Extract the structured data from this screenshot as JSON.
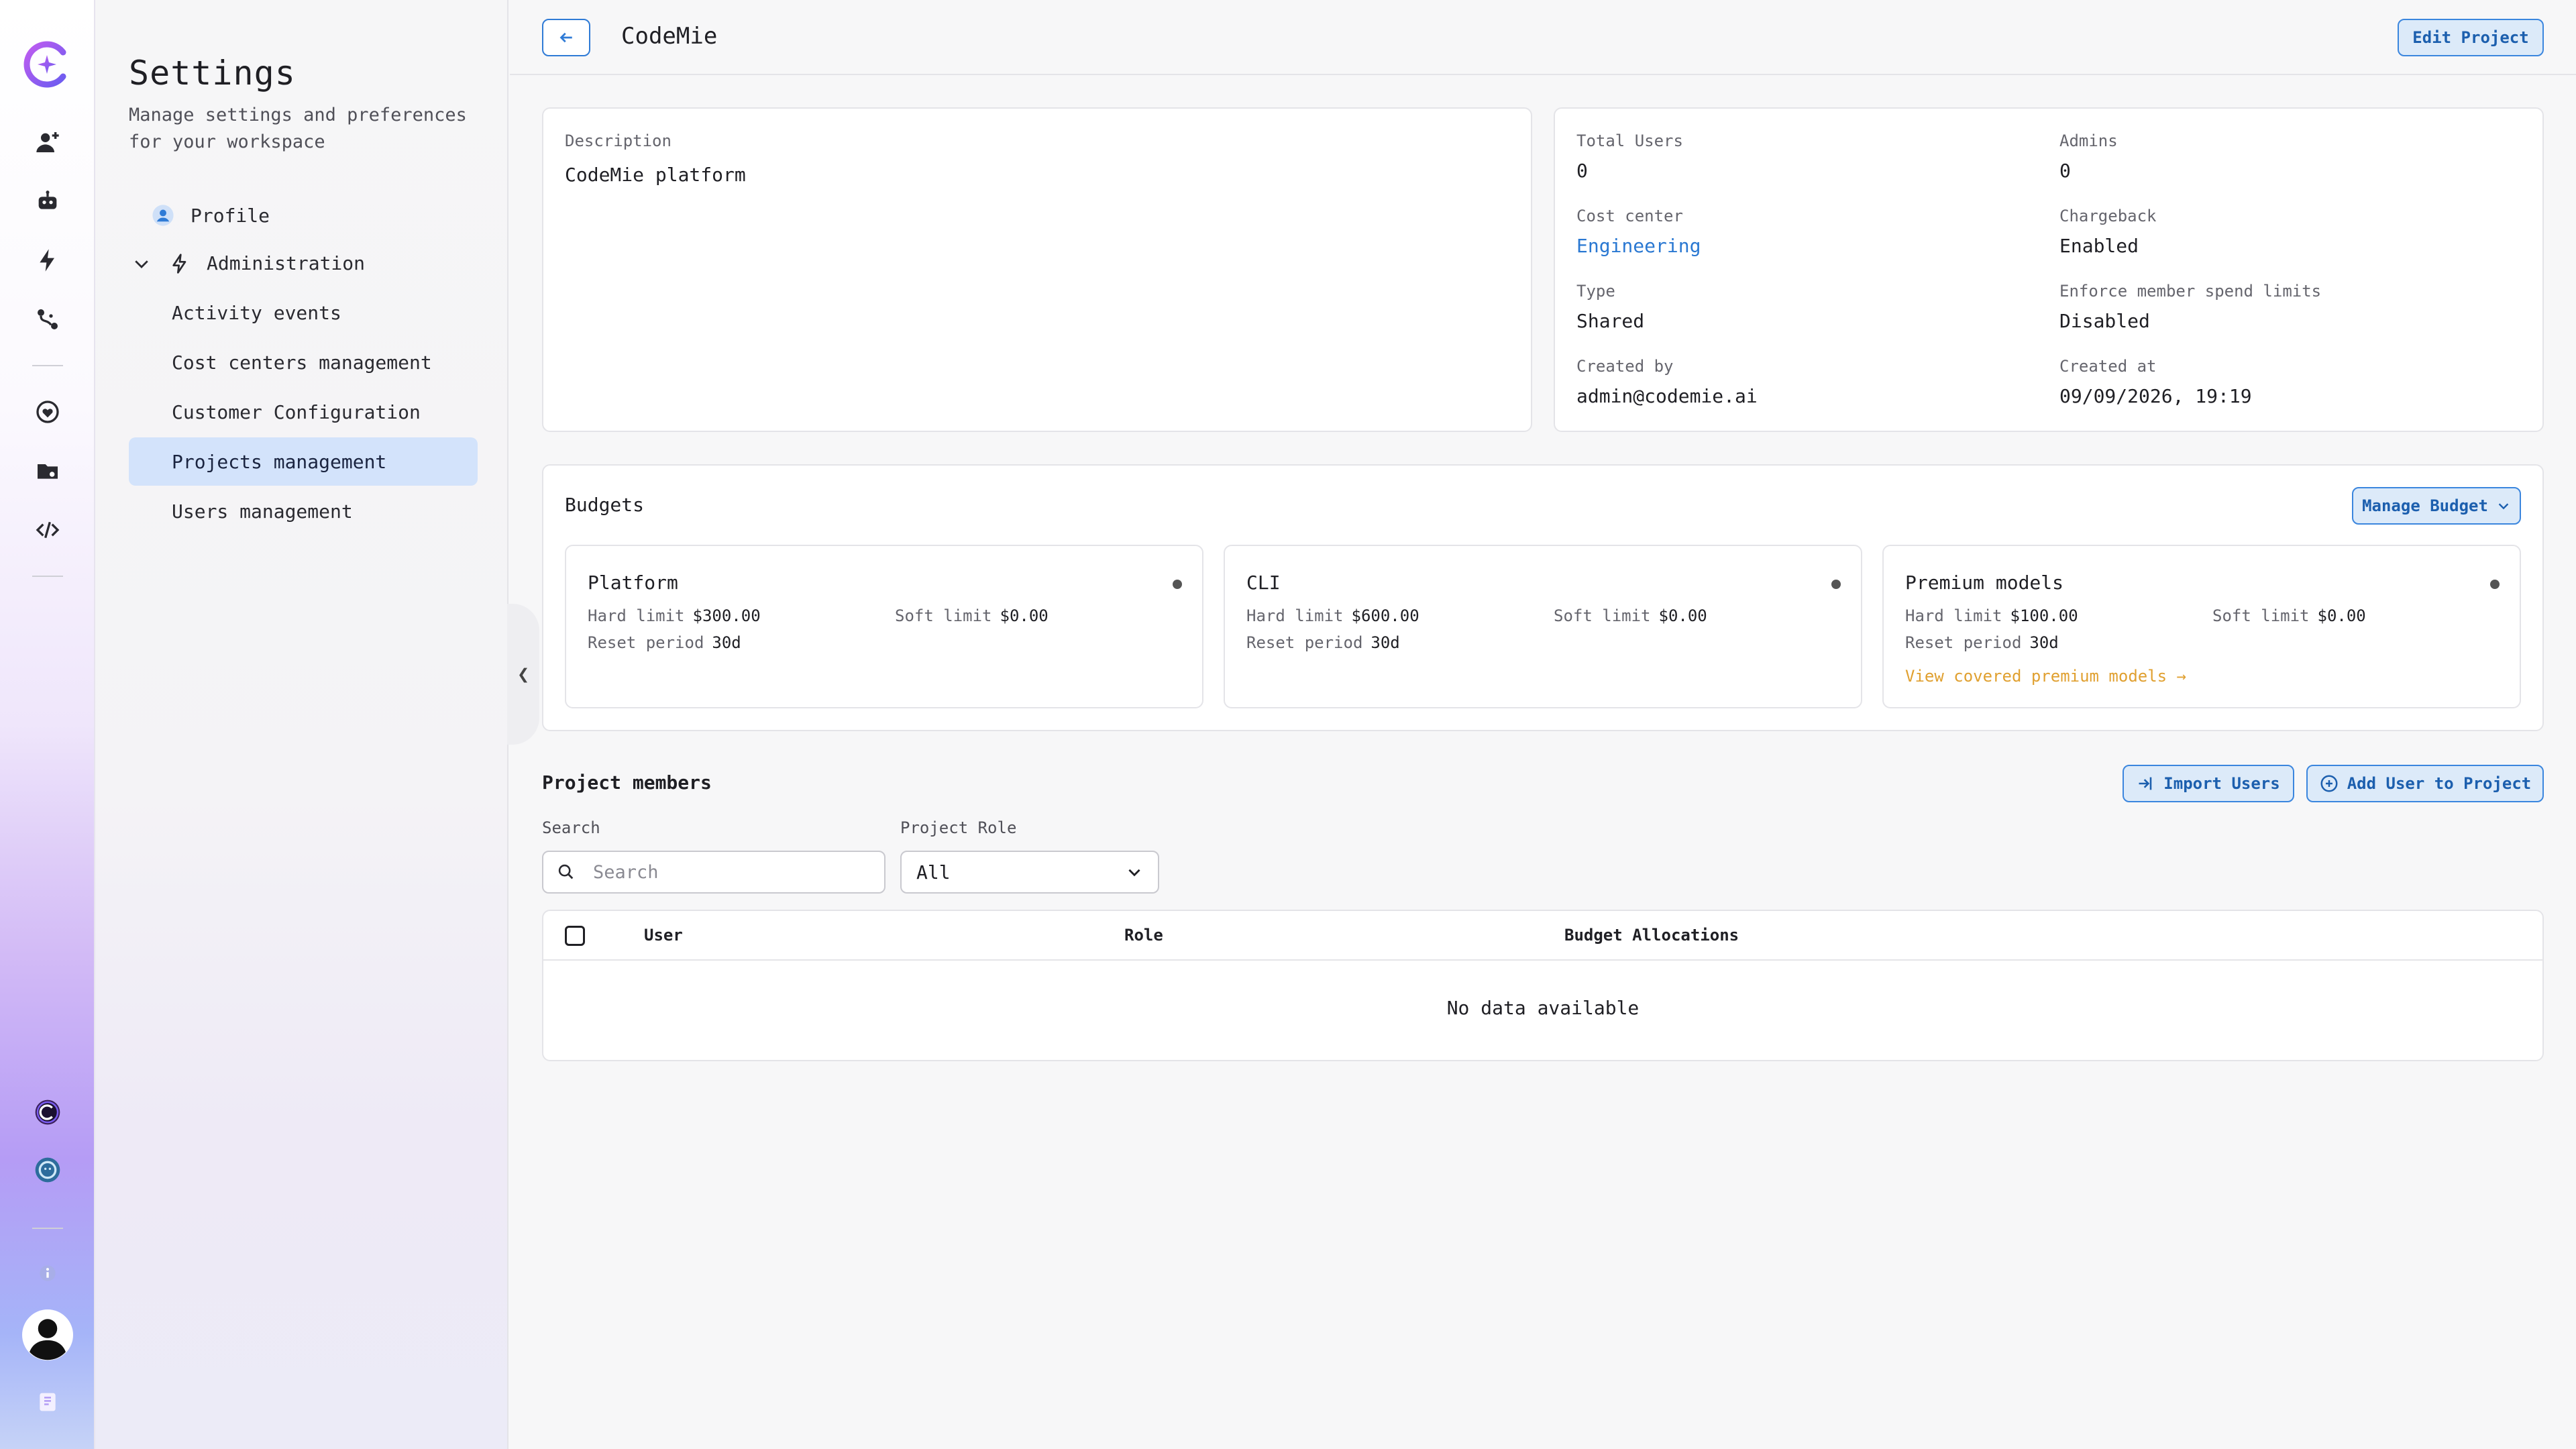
{
  "colors": {
    "accent": "#2f7bd6",
    "brand": "#9b5de5",
    "active_nav_bg": "#d3e3fb",
    "premium_link": "#e0a030"
  },
  "rail": {
    "icons": [
      "add-user-icon",
      "robot-icon",
      "lightning-icon",
      "workflow-icon",
      "heart-brain-icon",
      "folder-icon",
      "code-icon",
      "codemie-badge-icon",
      "lion-badge-icon",
      "info-icon",
      "user-avatar",
      "book-icon"
    ]
  },
  "sidebar": {
    "title": "Settings",
    "subtitle": "Manage settings and preferences for your workspace",
    "profile": "Profile",
    "administration": "Administration",
    "items": [
      {
        "label": "Activity events"
      },
      {
        "label": "Cost centers management"
      },
      {
        "label": "Customer Configuration"
      },
      {
        "label": "Projects management",
        "active": true
      },
      {
        "label": "Users management"
      }
    ]
  },
  "header": {
    "title": "CodeMie",
    "edit_label": "Edit Project"
  },
  "details": {
    "description_label": "Description",
    "description": "CodeMie platform",
    "total_users_label": "Total Users",
    "total_users": "0",
    "admins_label": "Admins",
    "admins": "0",
    "cost_center_label": "Cost center",
    "cost_center": "Engineering",
    "chargeback_label": "Chargeback",
    "chargeback": "Enabled",
    "type_label": "Type",
    "type": "Shared",
    "enforce_label": "Enforce member spend limits",
    "enforce": "Disabled",
    "created_by_label": "Created by",
    "created_by": "admin@codemie.ai",
    "created_at_label": "Created at",
    "created_at": "09/09/2026, 19:19"
  },
  "budgets": {
    "title": "Budgets",
    "manage_label": "Manage Budget",
    "hard_label": "Hard limit",
    "soft_label": "Soft limit",
    "reset_label": "Reset period",
    "cards": [
      {
        "name": "Platform",
        "hard": "$300.00",
        "soft": "$0.00",
        "reset": "30d"
      },
      {
        "name": "CLI",
        "hard": "$600.00",
        "soft": "$0.00",
        "reset": "30d"
      },
      {
        "name": "Premium models",
        "hard": "$100.00",
        "soft": "$0.00",
        "reset": "30d",
        "link": "View covered premium models →"
      }
    ]
  },
  "members": {
    "title": "Project members",
    "import_label": "Import Users",
    "add_label": "Add User to Project",
    "search_label": "Search",
    "search_placeholder": "Search",
    "role_label": "Project Role",
    "role_value": "All",
    "columns": [
      "User",
      "Role",
      "Budget Allocations"
    ],
    "empty": "No data available"
  }
}
